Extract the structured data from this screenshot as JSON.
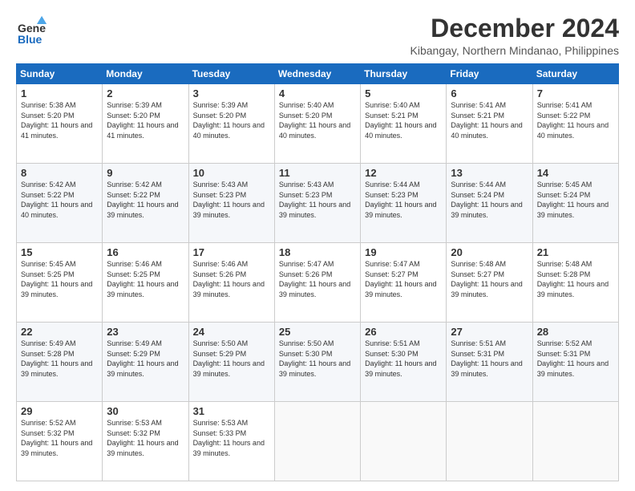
{
  "logo": {
    "line1": "General",
    "line2": "Blue"
  },
  "title": "December 2024",
  "location": "Kibangay, Northern Mindanao, Philippines",
  "days_of_week": [
    "Sunday",
    "Monday",
    "Tuesday",
    "Wednesday",
    "Thursday",
    "Friday",
    "Saturday"
  ],
  "weeks": [
    [
      {
        "day": 1,
        "sunrise": "5:38 AM",
        "sunset": "5:20 PM",
        "daylight": "11 hours and 41 minutes."
      },
      {
        "day": 2,
        "sunrise": "5:39 AM",
        "sunset": "5:20 PM",
        "daylight": "11 hours and 41 minutes."
      },
      {
        "day": 3,
        "sunrise": "5:39 AM",
        "sunset": "5:20 PM",
        "daylight": "11 hours and 40 minutes."
      },
      {
        "day": 4,
        "sunrise": "5:40 AM",
        "sunset": "5:20 PM",
        "daylight": "11 hours and 40 minutes."
      },
      {
        "day": 5,
        "sunrise": "5:40 AM",
        "sunset": "5:21 PM",
        "daylight": "11 hours and 40 minutes."
      },
      {
        "day": 6,
        "sunrise": "5:41 AM",
        "sunset": "5:21 PM",
        "daylight": "11 hours and 40 minutes."
      },
      {
        "day": 7,
        "sunrise": "5:41 AM",
        "sunset": "5:22 PM",
        "daylight": "11 hours and 40 minutes."
      }
    ],
    [
      {
        "day": 8,
        "sunrise": "5:42 AM",
        "sunset": "5:22 PM",
        "daylight": "11 hours and 40 minutes."
      },
      {
        "day": 9,
        "sunrise": "5:42 AM",
        "sunset": "5:22 PM",
        "daylight": "11 hours and 39 minutes."
      },
      {
        "day": 10,
        "sunrise": "5:43 AM",
        "sunset": "5:23 PM",
        "daylight": "11 hours and 39 minutes."
      },
      {
        "day": 11,
        "sunrise": "5:43 AM",
        "sunset": "5:23 PM",
        "daylight": "11 hours and 39 minutes."
      },
      {
        "day": 12,
        "sunrise": "5:44 AM",
        "sunset": "5:23 PM",
        "daylight": "11 hours and 39 minutes."
      },
      {
        "day": 13,
        "sunrise": "5:44 AM",
        "sunset": "5:24 PM",
        "daylight": "11 hours and 39 minutes."
      },
      {
        "day": 14,
        "sunrise": "5:45 AM",
        "sunset": "5:24 PM",
        "daylight": "11 hours and 39 minutes."
      }
    ],
    [
      {
        "day": 15,
        "sunrise": "5:45 AM",
        "sunset": "5:25 PM",
        "daylight": "11 hours and 39 minutes."
      },
      {
        "day": 16,
        "sunrise": "5:46 AM",
        "sunset": "5:25 PM",
        "daylight": "11 hours and 39 minutes."
      },
      {
        "day": 17,
        "sunrise": "5:46 AM",
        "sunset": "5:26 PM",
        "daylight": "11 hours and 39 minutes."
      },
      {
        "day": 18,
        "sunrise": "5:47 AM",
        "sunset": "5:26 PM",
        "daylight": "11 hours and 39 minutes."
      },
      {
        "day": 19,
        "sunrise": "5:47 AM",
        "sunset": "5:27 PM",
        "daylight": "11 hours and 39 minutes."
      },
      {
        "day": 20,
        "sunrise": "5:48 AM",
        "sunset": "5:27 PM",
        "daylight": "11 hours and 39 minutes."
      },
      {
        "day": 21,
        "sunrise": "5:48 AM",
        "sunset": "5:28 PM",
        "daylight": "11 hours and 39 minutes."
      }
    ],
    [
      {
        "day": 22,
        "sunrise": "5:49 AM",
        "sunset": "5:28 PM",
        "daylight": "11 hours and 39 minutes."
      },
      {
        "day": 23,
        "sunrise": "5:49 AM",
        "sunset": "5:29 PM",
        "daylight": "11 hours and 39 minutes."
      },
      {
        "day": 24,
        "sunrise": "5:50 AM",
        "sunset": "5:29 PM",
        "daylight": "11 hours and 39 minutes."
      },
      {
        "day": 25,
        "sunrise": "5:50 AM",
        "sunset": "5:30 PM",
        "daylight": "11 hours and 39 minutes."
      },
      {
        "day": 26,
        "sunrise": "5:51 AM",
        "sunset": "5:30 PM",
        "daylight": "11 hours and 39 minutes."
      },
      {
        "day": 27,
        "sunrise": "5:51 AM",
        "sunset": "5:31 PM",
        "daylight": "11 hours and 39 minutes."
      },
      {
        "day": 28,
        "sunrise": "5:52 AM",
        "sunset": "5:31 PM",
        "daylight": "11 hours and 39 minutes."
      }
    ],
    [
      {
        "day": 29,
        "sunrise": "5:52 AM",
        "sunset": "5:32 PM",
        "daylight": "11 hours and 39 minutes."
      },
      {
        "day": 30,
        "sunrise": "5:53 AM",
        "sunset": "5:32 PM",
        "daylight": "11 hours and 39 minutes."
      },
      {
        "day": 31,
        "sunrise": "5:53 AM",
        "sunset": "5:33 PM",
        "daylight": "11 hours and 39 minutes."
      },
      null,
      null,
      null,
      null
    ]
  ]
}
